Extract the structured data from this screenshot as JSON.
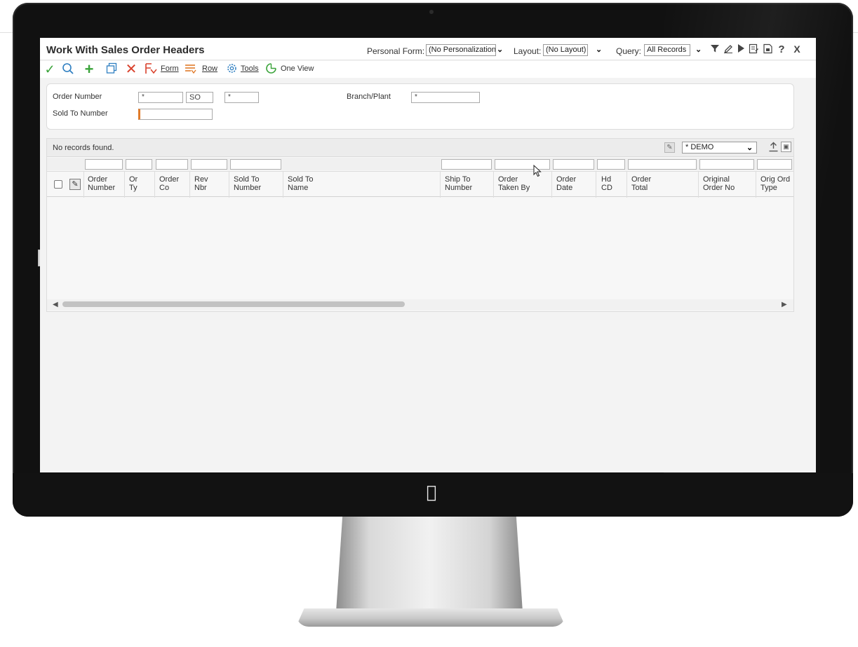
{
  "window": {
    "title": "Work With Sales Order Headers",
    "personal_form_label": "Personal Form:",
    "personal_form_value": "(No Personalization)",
    "layout_label": "Layout:",
    "layout_value": "(No Layout)",
    "query_label": "Query:",
    "query_value": "All Records"
  },
  "toolbar": {
    "form_label": "Form",
    "row_label": "Row",
    "tools_label": "Tools",
    "oneview_label": "One View"
  },
  "query": {
    "order_number_label": "Order Number",
    "order_number_value": "*",
    "order_type_value": "SO",
    "order_company_value": "*",
    "branch_plant_label": "Branch/Plant",
    "branch_plant_value": "*",
    "sold_to_label": "Sold To Number",
    "sold_to_value": ""
  },
  "grid": {
    "message": "No records found.",
    "view_select": "* DEMO",
    "columns": [
      {
        "l1": "Order",
        "l2": "Number"
      },
      {
        "l1": "Or",
        "l2": "Ty"
      },
      {
        "l1": "Order",
        "l2": "Co"
      },
      {
        "l1": "Rev",
        "l2": "Nbr"
      },
      {
        "l1": "Sold To",
        "l2": "Number"
      },
      {
        "l1": "Sold To",
        "l2": "Name"
      },
      {
        "l1": "Ship To",
        "l2": "Number"
      },
      {
        "l1": "Order",
        "l2": "Taken By"
      },
      {
        "l1": "Order",
        "l2": "Date"
      },
      {
        "l1": "Hd",
        "l2": "CD"
      },
      {
        "l1": "Order",
        "l2": "Total"
      },
      {
        "l1": "Original",
        "l2": "Order No"
      },
      {
        "l1": "Orig Ord",
        "l2": "Type"
      }
    ]
  },
  "colors": {
    "accent_green": "#3aa33a",
    "close_red": "#d9412c",
    "search_blue": "#2f7fc1",
    "icon_orange": "#e07b2a"
  }
}
